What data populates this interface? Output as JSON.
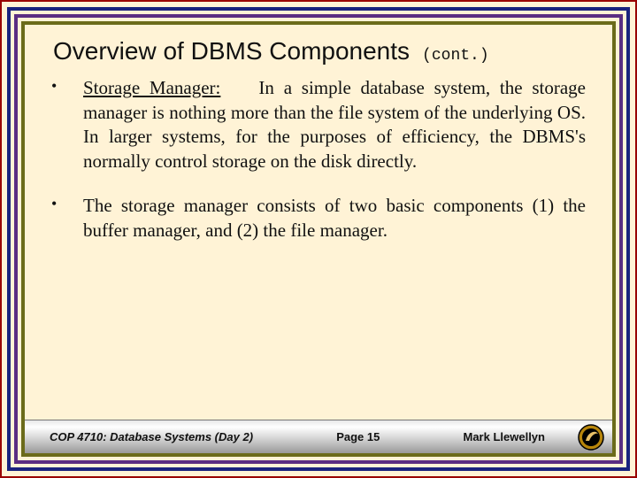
{
  "title": "Overview of DBMS Components",
  "cont": "(cont.)",
  "bullets": [
    {
      "term": "Storage Manager:",
      "text": " In a simple database system, the storage manager is nothing more than the file system of the underlying OS. In larger systems, for the purposes of efficiency, the DBMS's normally control storage on the disk directly."
    },
    {
      "term": "",
      "text": "The storage manager consists of two basic components (1) the buffer manager, and (2) the file manager."
    }
  ],
  "footer": {
    "course": "COP 4710: Database Systems (Day 2)",
    "page": "Page 15",
    "author": "Mark Llewellyn"
  }
}
